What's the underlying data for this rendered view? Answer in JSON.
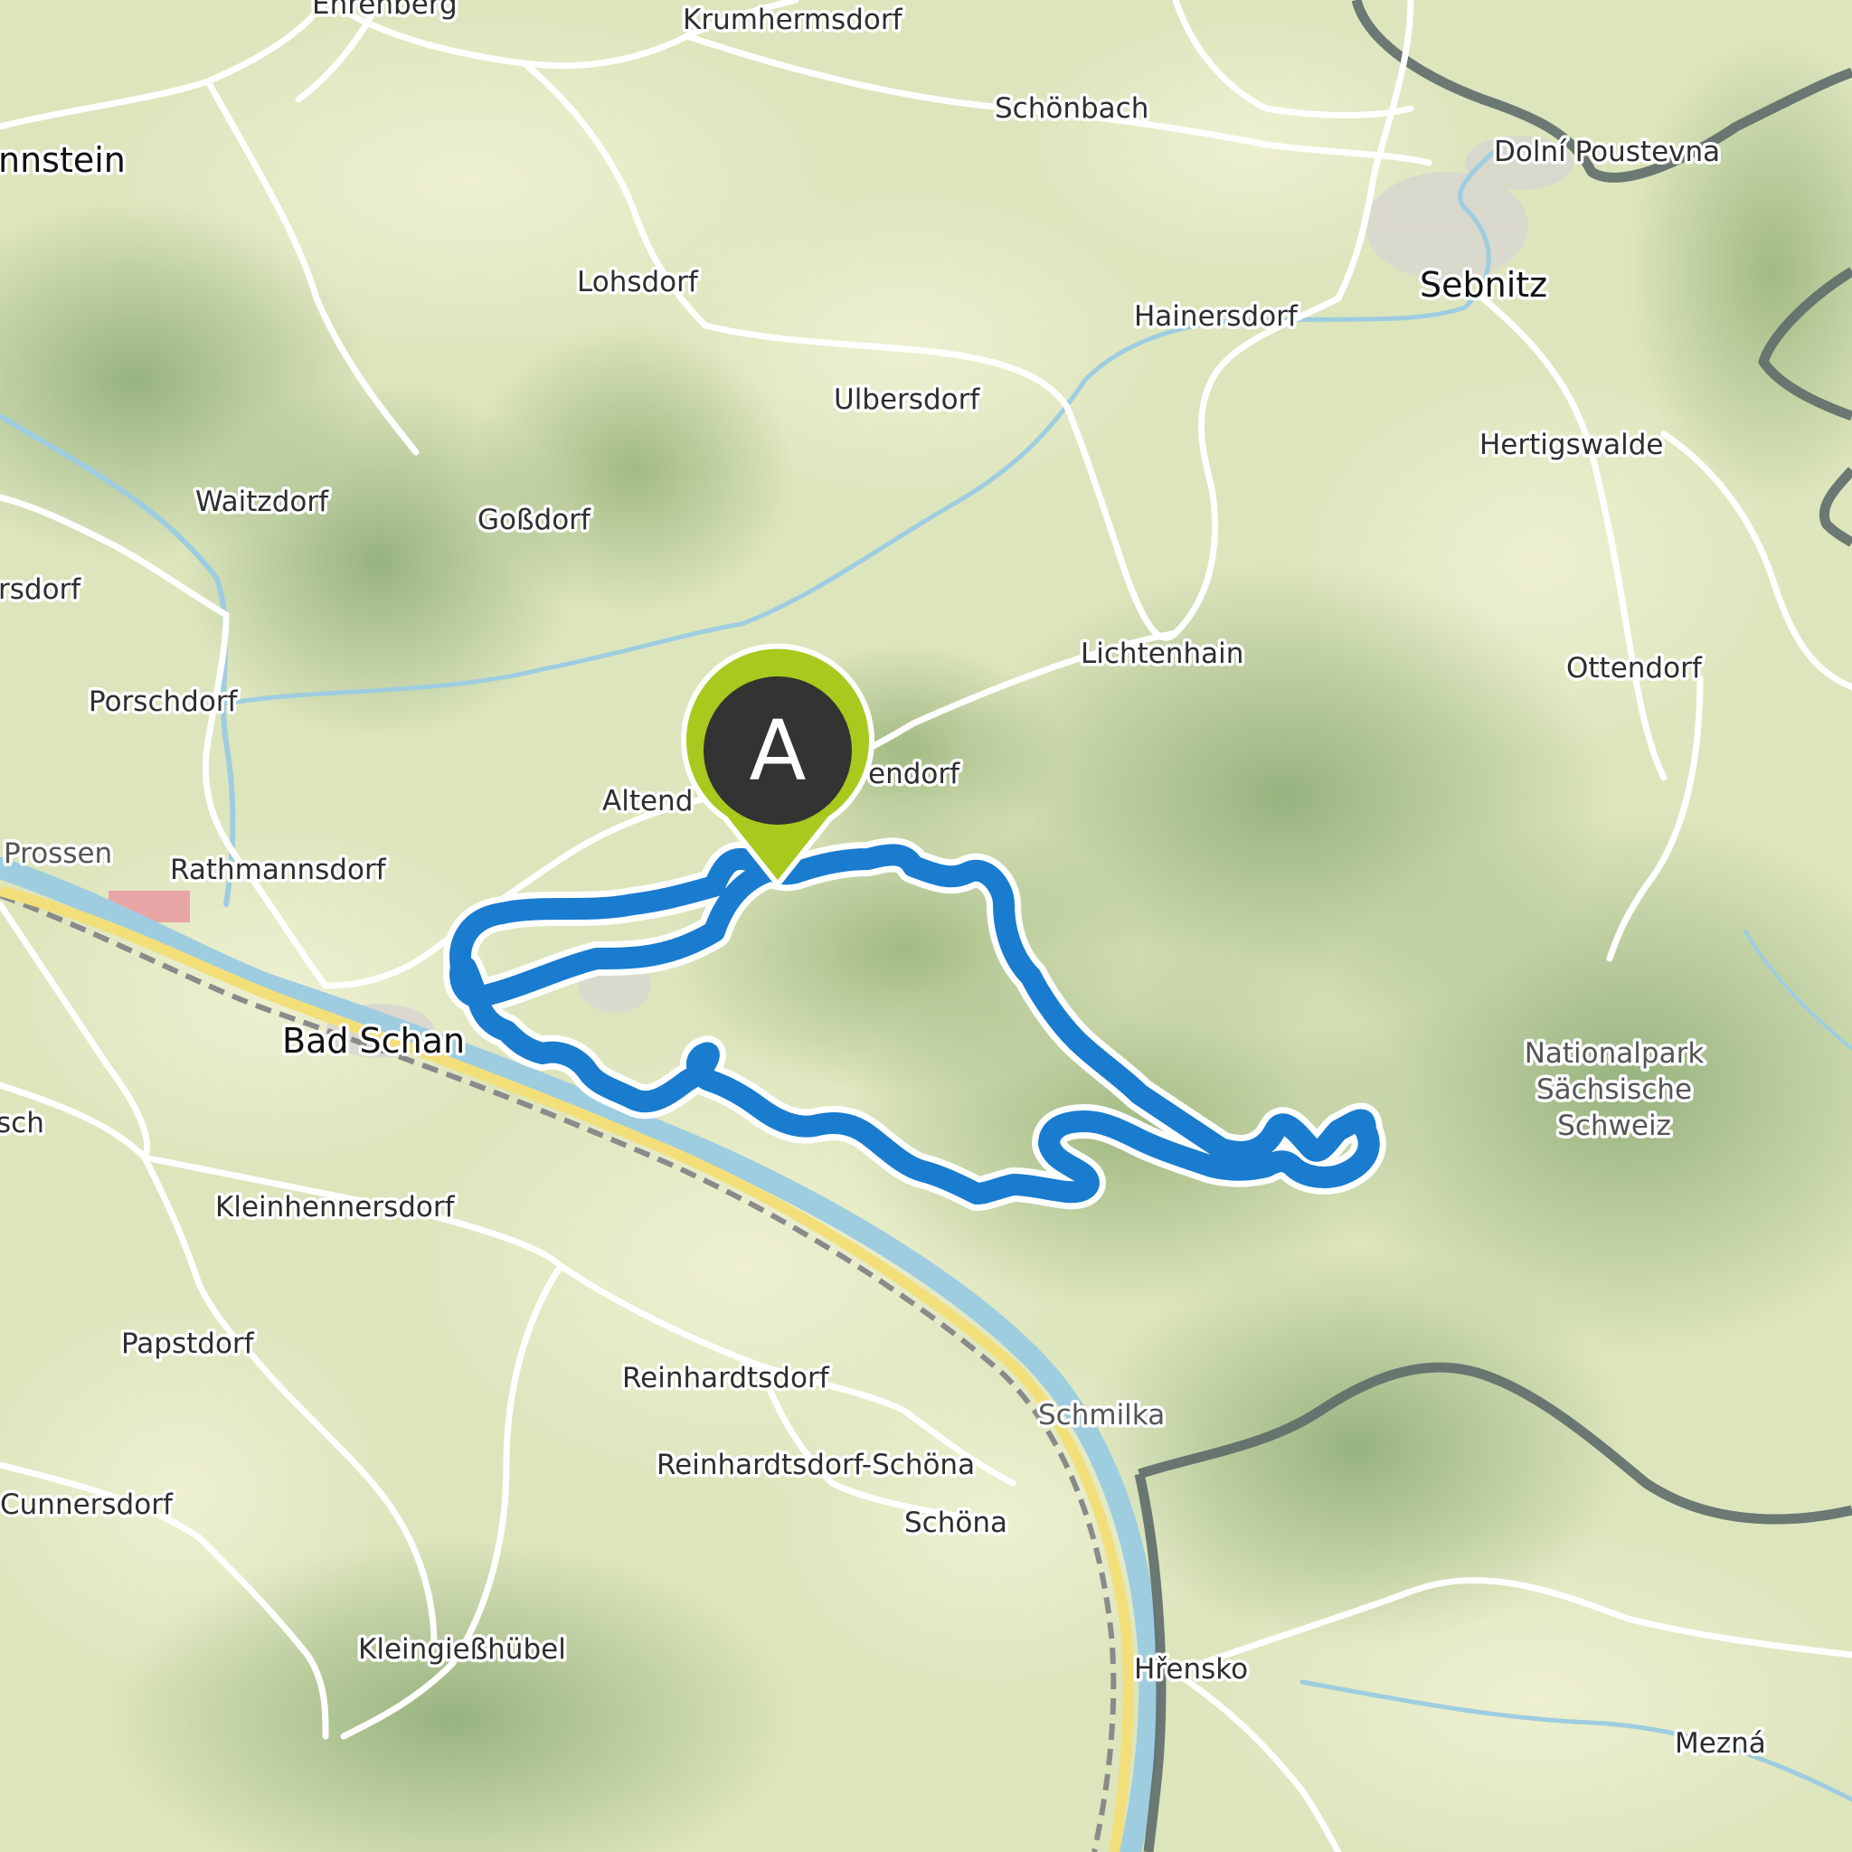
{
  "map": {
    "route_color": "#1a7ccf",
    "marker_color": "#a8c91e",
    "marker_label": "A",
    "places": [
      {
        "id": "ehrenberg",
        "label": "Ehrenberg"
      },
      {
        "id": "krumhermsdorf",
        "label": "Krumhermsdorf"
      },
      {
        "id": "schonbach",
        "label": "Schönbach"
      },
      {
        "id": "dolni-poustevna",
        "label": "Dolní Poustevna"
      },
      {
        "id": "hohnstein",
        "label": "nnstein"
      },
      {
        "id": "sebnitz",
        "label": "Sebnitz"
      },
      {
        "id": "lohsdorf",
        "label": "Lohsdorf"
      },
      {
        "id": "hainersdorf",
        "label": "Hainersdorf"
      },
      {
        "id": "ulbersdorf",
        "label": "Ulbersdorf"
      },
      {
        "id": "hertigswalde",
        "label": "Hertigswalde"
      },
      {
        "id": "waitzdorf",
        "label": "Waitzdorf"
      },
      {
        "id": "gossdorf",
        "label": "Goßdorf"
      },
      {
        "id": "sdorf",
        "label": "rsdorf"
      },
      {
        "id": "lichtenhain",
        "label": "Lichtenhain"
      },
      {
        "id": "ottendorf",
        "label": "Ottendorf"
      },
      {
        "id": "porschdorf",
        "label": "Porschdorf"
      },
      {
        "id": "altendorf",
        "label": "Altend"
      },
      {
        "id": "mittelndorf",
        "label": "endorf"
      },
      {
        "id": "prossen",
        "label": "Prossen"
      },
      {
        "id": "rathmannsdorf",
        "label": "Rathmannsdorf"
      },
      {
        "id": "bad-schandau",
        "label": "Bad Schan"
      },
      {
        "id": "sch",
        "label": "sch"
      },
      {
        "id": "kleinhennersdorf",
        "label": "Kleinhennersdorf"
      },
      {
        "id": "papstdorf",
        "label": "Papstdorf"
      },
      {
        "id": "reinhardtsdorf",
        "label": "Reinhardtsdorf"
      },
      {
        "id": "schmilka",
        "label": "Schmilka"
      },
      {
        "id": "reinhardtsdorf-schona",
        "label": "Reinhardtsdorf-Schöna"
      },
      {
        "id": "schona",
        "label": "Schöna"
      },
      {
        "id": "cunnersdorf",
        "label": "Cunnersdorf"
      },
      {
        "id": "kleingiesshubel",
        "label": "Kleingießhübel"
      },
      {
        "id": "hrensko",
        "label": "Hřensko"
      },
      {
        "id": "mezna",
        "label": "Mezná"
      }
    ],
    "park": {
      "line1": "Nationalpark",
      "line2": "Sächsische",
      "line3": "Schweiz"
    }
  }
}
